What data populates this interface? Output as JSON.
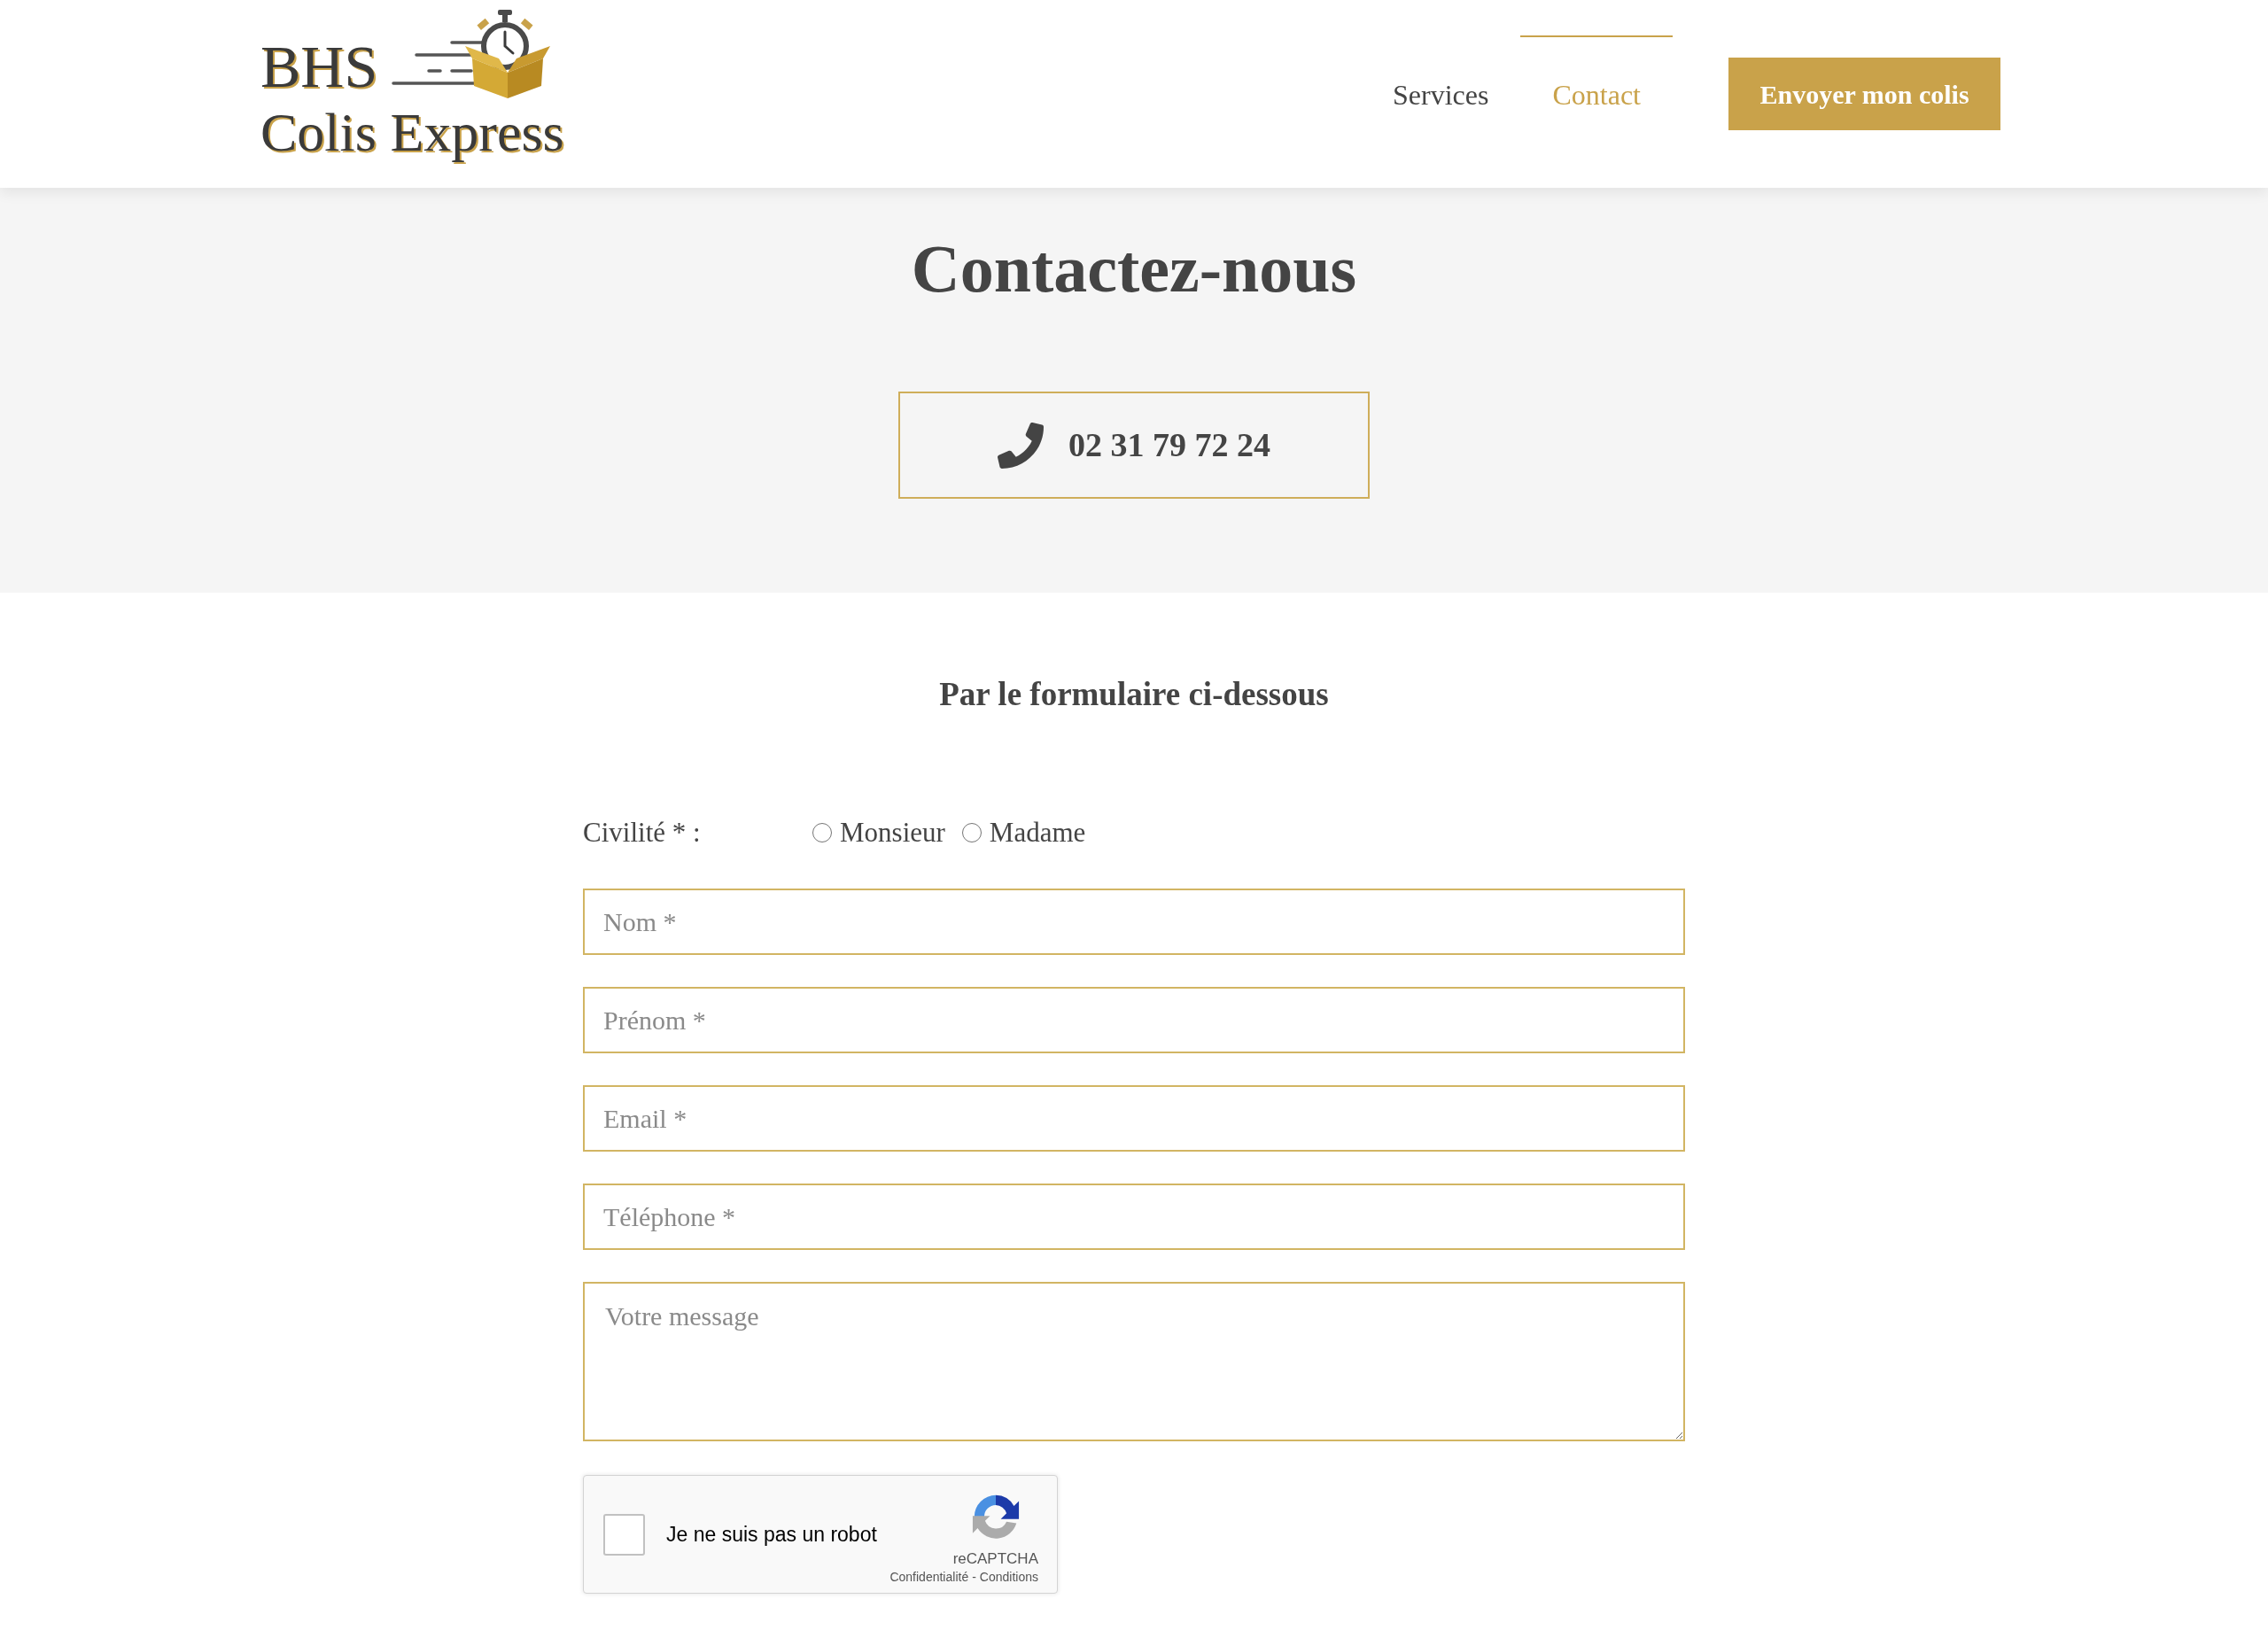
{
  "header": {
    "logo": {
      "line_1": "BHS",
      "line_2": "Colis Express"
    },
    "nav": [
      {
        "label": "Services",
        "selected": false
      },
      {
        "label": "Contact",
        "selected": true
      }
    ],
    "cta_button": "Envoyer mon colis"
  },
  "hero": {
    "title": "Contactez-nous",
    "phone": "02 31 79 72 24"
  },
  "form_section": {
    "subtitle": "Par le formulaire ci-dessous",
    "civility": {
      "label": "Civilité * :",
      "options": [
        {
          "label": "Monsieur",
          "selected": false
        },
        {
          "label": "Madame",
          "selected": false
        }
      ]
    },
    "fields": [
      {
        "kind": "input",
        "placeholder": "Nom *"
      },
      {
        "kind": "input",
        "placeholder": "Prénom *"
      },
      {
        "kind": "input",
        "placeholder": "Email *"
      },
      {
        "kind": "input",
        "placeholder": "Téléphone *"
      },
      {
        "kind": "textarea",
        "placeholder": "Votre message"
      }
    ],
    "captcha": {
      "label": "Je ne suis pas un robot",
      "checked": false,
      "brand": "reCAPTCHA",
      "links": [
        "Confidentialité",
        "Conditions"
      ],
      "separator": "-"
    }
  }
}
